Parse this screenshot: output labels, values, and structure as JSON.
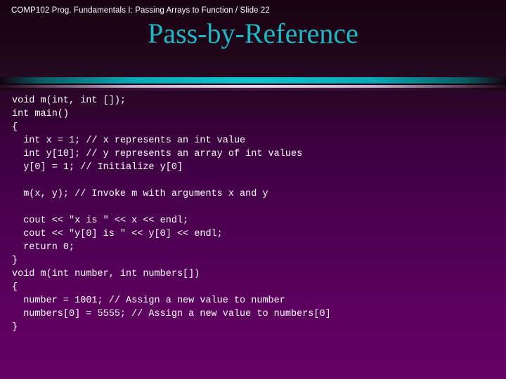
{
  "slide": {
    "breadcrumb": "COMP102  Prog. Fundamentals I: Passing Arrays to Function / Slide 22",
    "title": "Pass-by-Reference",
    "code": "void m(int, int []);\nint main()\n{\n  int x = 1; // x represents an int value\n  int y[10]; // y represents an array of int values\n  y[0] = 1; // Initialize y[0]\n\n  m(x, y); // Invoke m with arguments x and y\n\n  cout << \"x is \" << x << endl;\n  cout << \"y[0] is \" << y[0] << endl;\n  return 0;\n}\nvoid m(int number, int numbers[])\n{\n  number = 1001; // Assign a new value to number\n  numbers[0] = 5555; // Assign a new value to numbers[0]\n}",
    "code_lines": [
      "void m(int, int []);",
      "int main()",
      "{",
      "  int x = 1; // x represents an int value",
      "  int y[10]; // y represents an array of int values",
      "  y[0] = 1; // Initialize y[0]",
      "",
      "  m(x, y); // Invoke m with arguments x and y",
      "",
      "  cout << \"x is \" << x << endl;",
      "  cout << \"y[0] is \" << y[0] << endl;",
      "  return 0;",
      "}",
      "void m(int number, int numbers[])",
      "{",
      "  number = 1001; // Assign a new value to number",
      "  numbers[0] = 5555; // Assign a new value to numbers[0]",
      "}"
    ],
    "colors": {
      "header_background": "#1e0518",
      "title_text": "#1fb9c6",
      "breadcrumb_text": "#ffffff",
      "divider_teal": "#13c3cf",
      "divider_lavender": "#edd6f0",
      "body_background_top": "#2a0626",
      "body_background_bottom": "#660066",
      "code_text": "#ffffff"
    }
  }
}
